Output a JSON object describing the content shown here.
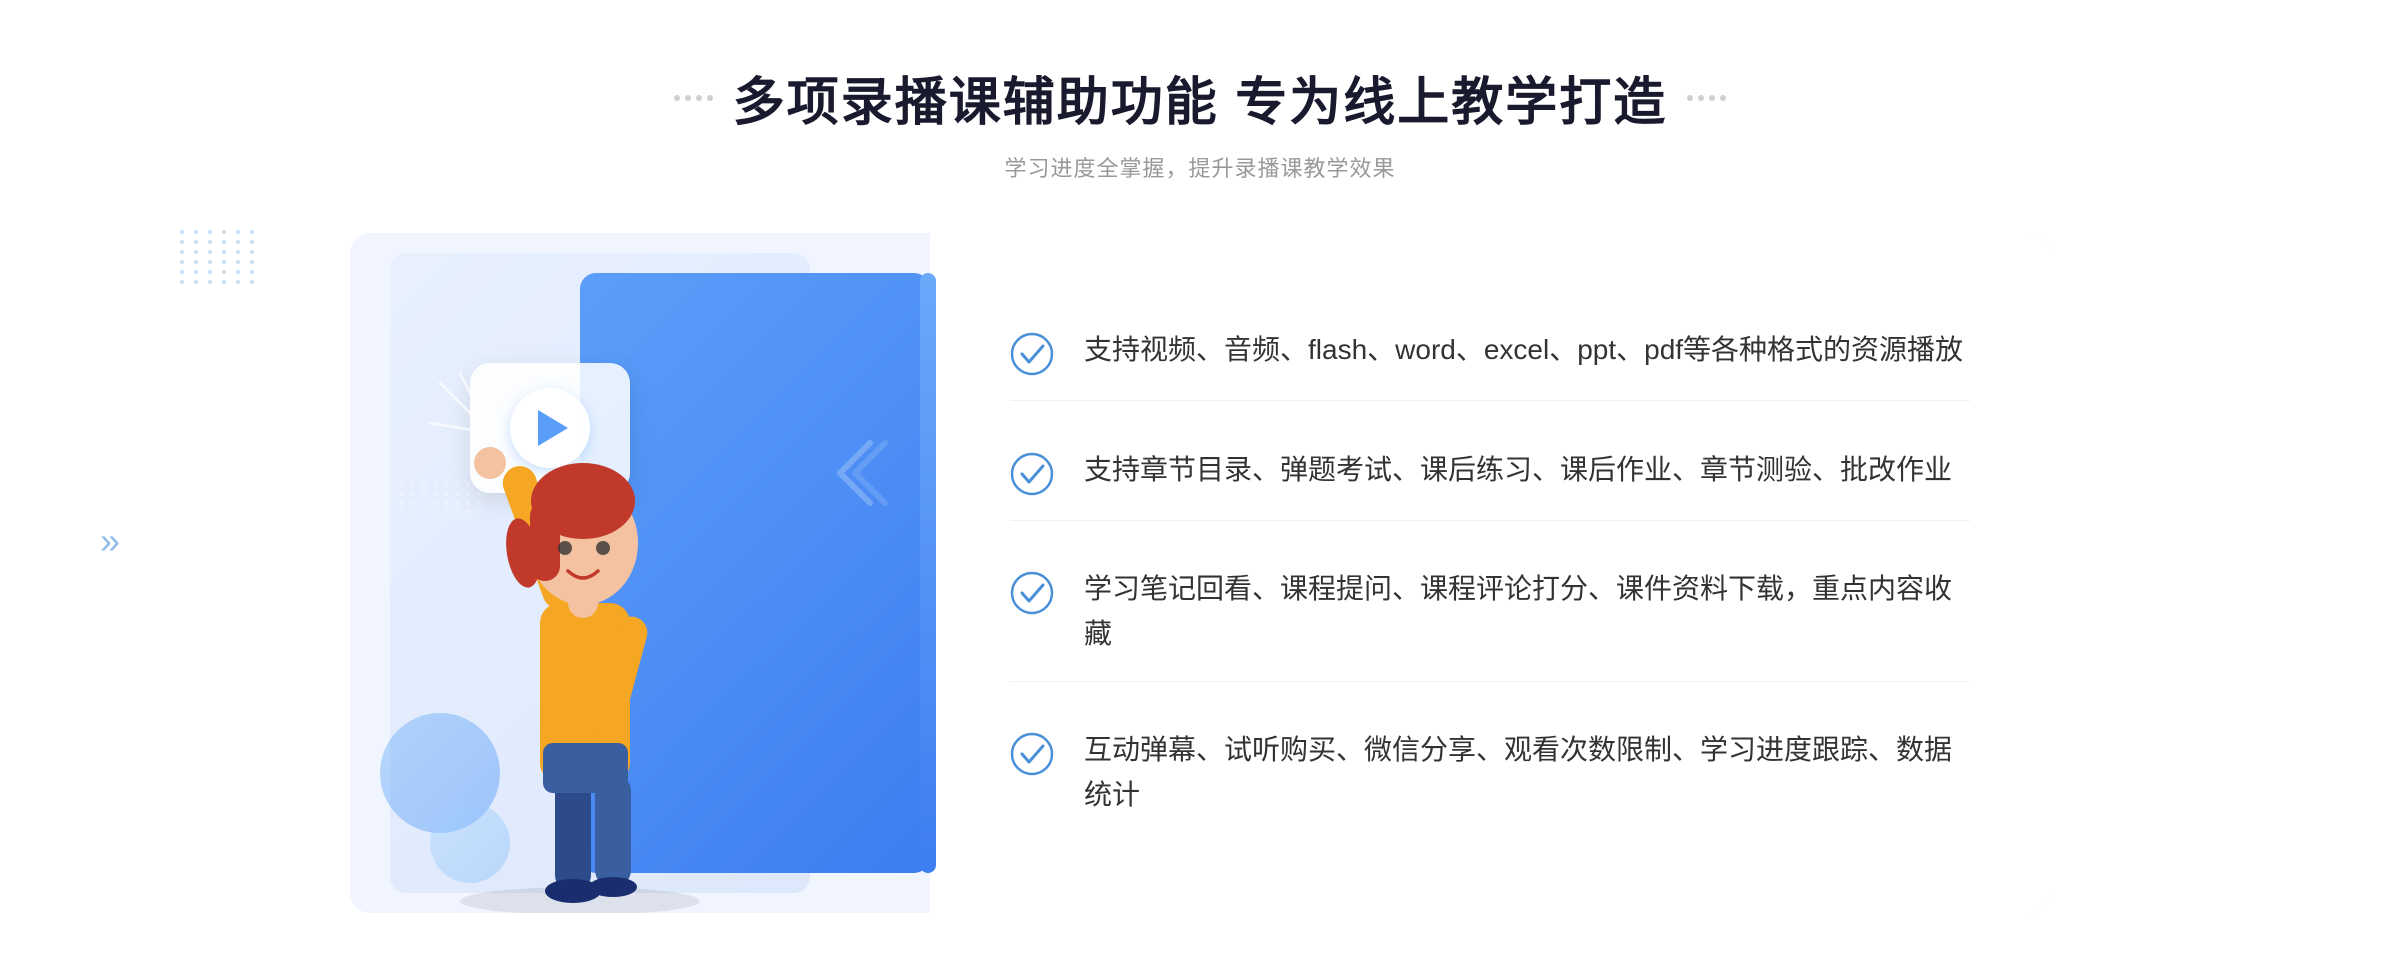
{
  "header": {
    "main_title": "多项录播课辅助功能 专为线上教学打造",
    "subtitle": "学习进度全掌握，提升录播课教学效果",
    "decorator_left": "⁚⁚",
    "decorator_right": "⁚⁚"
  },
  "features": [
    {
      "id": 1,
      "text": "支持视频、音频、flash、word、excel、ppt、pdf等各种格式的资源播放"
    },
    {
      "id": 2,
      "text": "支持章节目录、弹题考试、课后练习、课后作业、章节测验、批改作业"
    },
    {
      "id": 3,
      "text": "学习笔记回看、课程提问、课程评论打分、课件资料下载，重点内容收藏"
    },
    {
      "id": 4,
      "text": "互动弹幕、试听购买、微信分享、观看次数限制、学习进度跟踪、数据统计"
    }
  ],
  "colors": {
    "primary_blue": "#3d7ef0",
    "light_blue": "#6aa8fb",
    "bg_light": "#f0f5ff",
    "text_dark": "#1a1a2e",
    "text_gray": "#999999",
    "text_body": "#333333"
  },
  "illustration": {
    "play_alt": "play-button"
  }
}
